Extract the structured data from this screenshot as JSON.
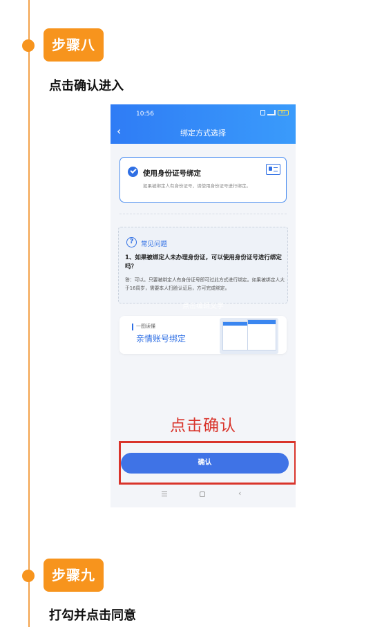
{
  "steps": [
    {
      "badge": "步骤八",
      "description": "点击确认进入"
    },
    {
      "badge": "步骤九",
      "description": "打勾并点击同意"
    }
  ],
  "phone": {
    "status_time": "10:56",
    "battery": "82",
    "nav_title": "绑定方式选择",
    "bind_option": {
      "title": "使用身份证号绑定",
      "subtitle": "如果被绑定人有身份证号，请使用身份证号进行绑定。"
    },
    "faq": {
      "title": "常见问题",
      "question": "1、如果被绑定人未办理身份证，可以使用身份证号进行绑定吗？",
      "answer": "答：可以。只要被绑定人有身份证号即可过此方式进行绑定。如果被绑定人大于16周岁，需要本人扫脸认证后，方可完成绑定。"
    },
    "edit_hint": "点击编辑文字",
    "promo": {
      "tag": "一图读懂",
      "title": "亲情账号绑定"
    },
    "callout": "点击确认",
    "confirm_label": "确认"
  },
  "colors": {
    "accent_orange": "#f7941d",
    "header_blue": "#2f7cf5",
    "button_blue": "#3f73e6",
    "highlight_red": "#d9342b"
  }
}
